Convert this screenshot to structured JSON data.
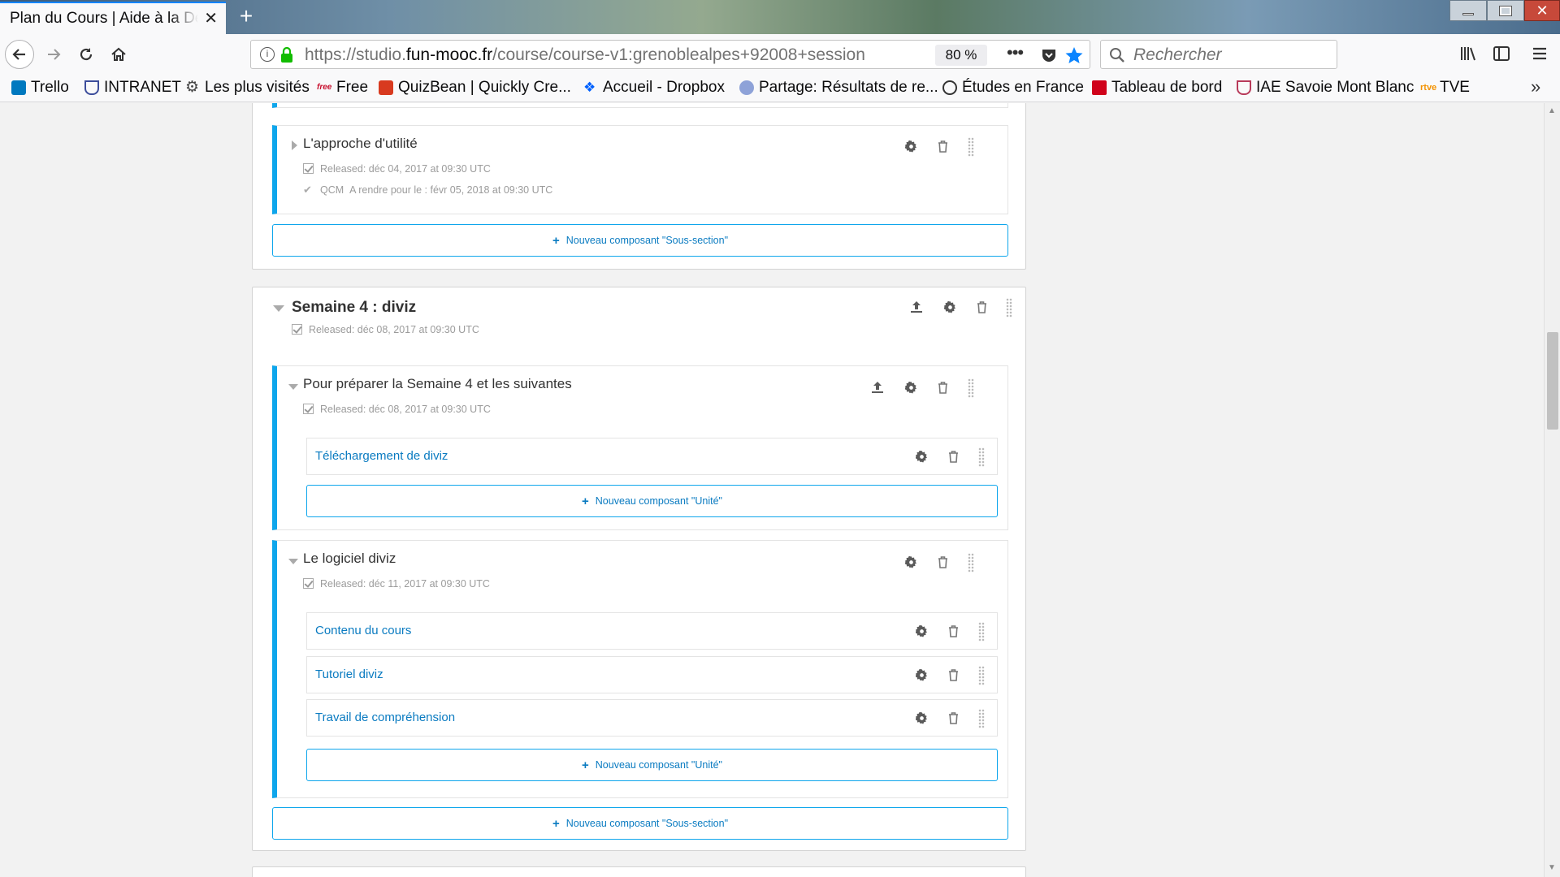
{
  "browser": {
    "tab_title": "Plan du Cours | Aide à la Dé",
    "url_prefix": "https://studio.",
    "url_host": "fun-mooc.fr",
    "url_rest": "/course/course-v1:grenoblealpes+92008+session",
    "zoom": "80 %",
    "search_placeholder": "Rechercher"
  },
  "bookmarks": [
    {
      "label": "Trello",
      "color": "#0079bf"
    },
    {
      "label": "INTRANET",
      "color": "#3c4d9b"
    },
    {
      "label": "Les plus visités",
      "color": "#444444"
    },
    {
      "label": "Free",
      "color": "#c8102e"
    },
    {
      "label": "QuizBean | Quickly Cre...",
      "color": "#d83a1f"
    },
    {
      "label": "Accueil - Dropbox",
      "color": "#0061fe"
    },
    {
      "label": "Partage: Résultats de re...",
      "color": "#8ea2d8"
    },
    {
      "label": "Études en France",
      "color": "#333333"
    },
    {
      "label": "Tableau de bord",
      "color": "#d0021b"
    },
    {
      "label": "IAE Savoie Mont Blanc",
      "color": "#b83a5a"
    },
    {
      "label": "TVE",
      "color": "#f39200"
    }
  ],
  "top_section": {
    "subsection": {
      "title": "L'approche d'utilité",
      "released": "Released: déc 04, 2017 at 09:30 UTC",
      "graded_type": "QCM",
      "due": "A rendre pour le : févr 05, 2018 at 09:30 UTC"
    },
    "add_subsection": "Nouveau composant \"Sous-section\""
  },
  "section": {
    "title": "Semaine 4 : diviz",
    "released": "Released: déc 08, 2017 at 09:30 UTC",
    "subsections": [
      {
        "title": "Pour préparer la Semaine 4 et les suivantes",
        "released": "Released: déc 08, 2017 at 09:30 UTC",
        "units": [
          "Téléchargement de diviz"
        ],
        "add_unit": "Nouveau composant \"Unité\""
      },
      {
        "title": "Le logiciel diviz",
        "released": "Released: déc 11, 2017 at 09:30 UTC",
        "units": [
          "Contenu du cours",
          "Tutoriel diviz",
          "Travail de compréhension"
        ],
        "add_unit": "Nouveau composant \"Unité\""
      }
    ],
    "add_subsection": "Nouveau composant \"Sous-section\""
  },
  "colors": {
    "accent": "#0ea6ec",
    "link": "#0a7bc1",
    "meta_text": "#9b9b9b"
  }
}
